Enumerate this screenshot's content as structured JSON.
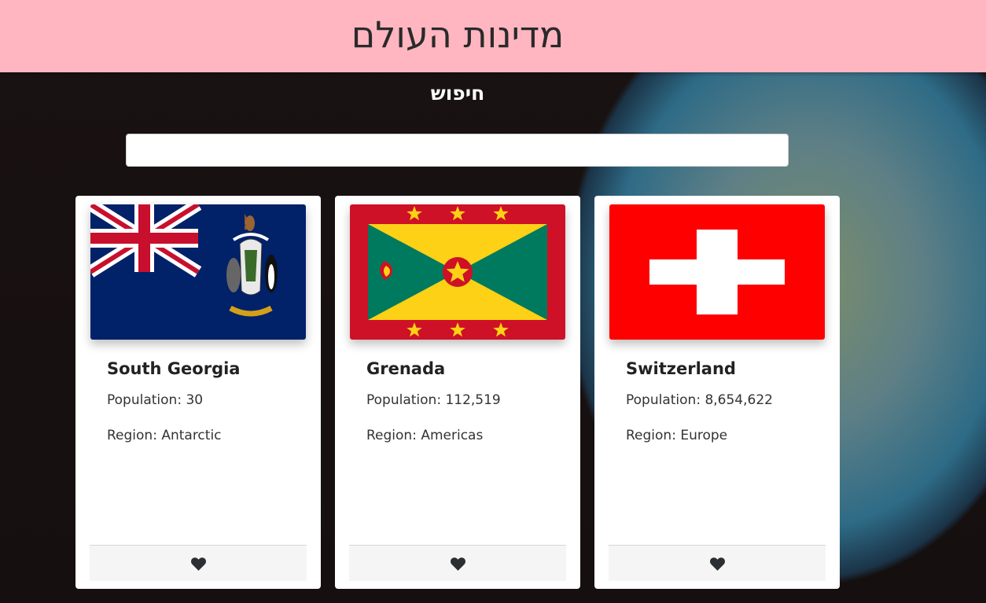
{
  "header": {
    "title": "מדינות העולם"
  },
  "search": {
    "label": "חיפוש",
    "placeholder": "",
    "value": ""
  },
  "colors": {
    "header_bg": "#ffb6c1",
    "card_bg": "#ffffff",
    "footer_bg": "#f5f5f5",
    "heart": "#2b2f33"
  },
  "cards": [
    {
      "name": "South Georgia",
      "population_label": "Population:",
      "population": "30",
      "region_label": "Region:",
      "region": "Antarctic",
      "flag_icon": "south-georgia-flag",
      "favorite_icon": "heart-icon"
    },
    {
      "name": "Grenada",
      "population_label": "Population:",
      "population": "112,519",
      "region_label": "Region:",
      "region": "Americas",
      "flag_icon": "grenada-flag",
      "favorite_icon": "heart-icon"
    },
    {
      "name": "Switzerland",
      "population_label": "Population:",
      "population": "8,654,622",
      "region_label": "Region:",
      "region": "Europe",
      "flag_icon": "switzerland-flag",
      "favorite_icon": "heart-icon"
    }
  ]
}
